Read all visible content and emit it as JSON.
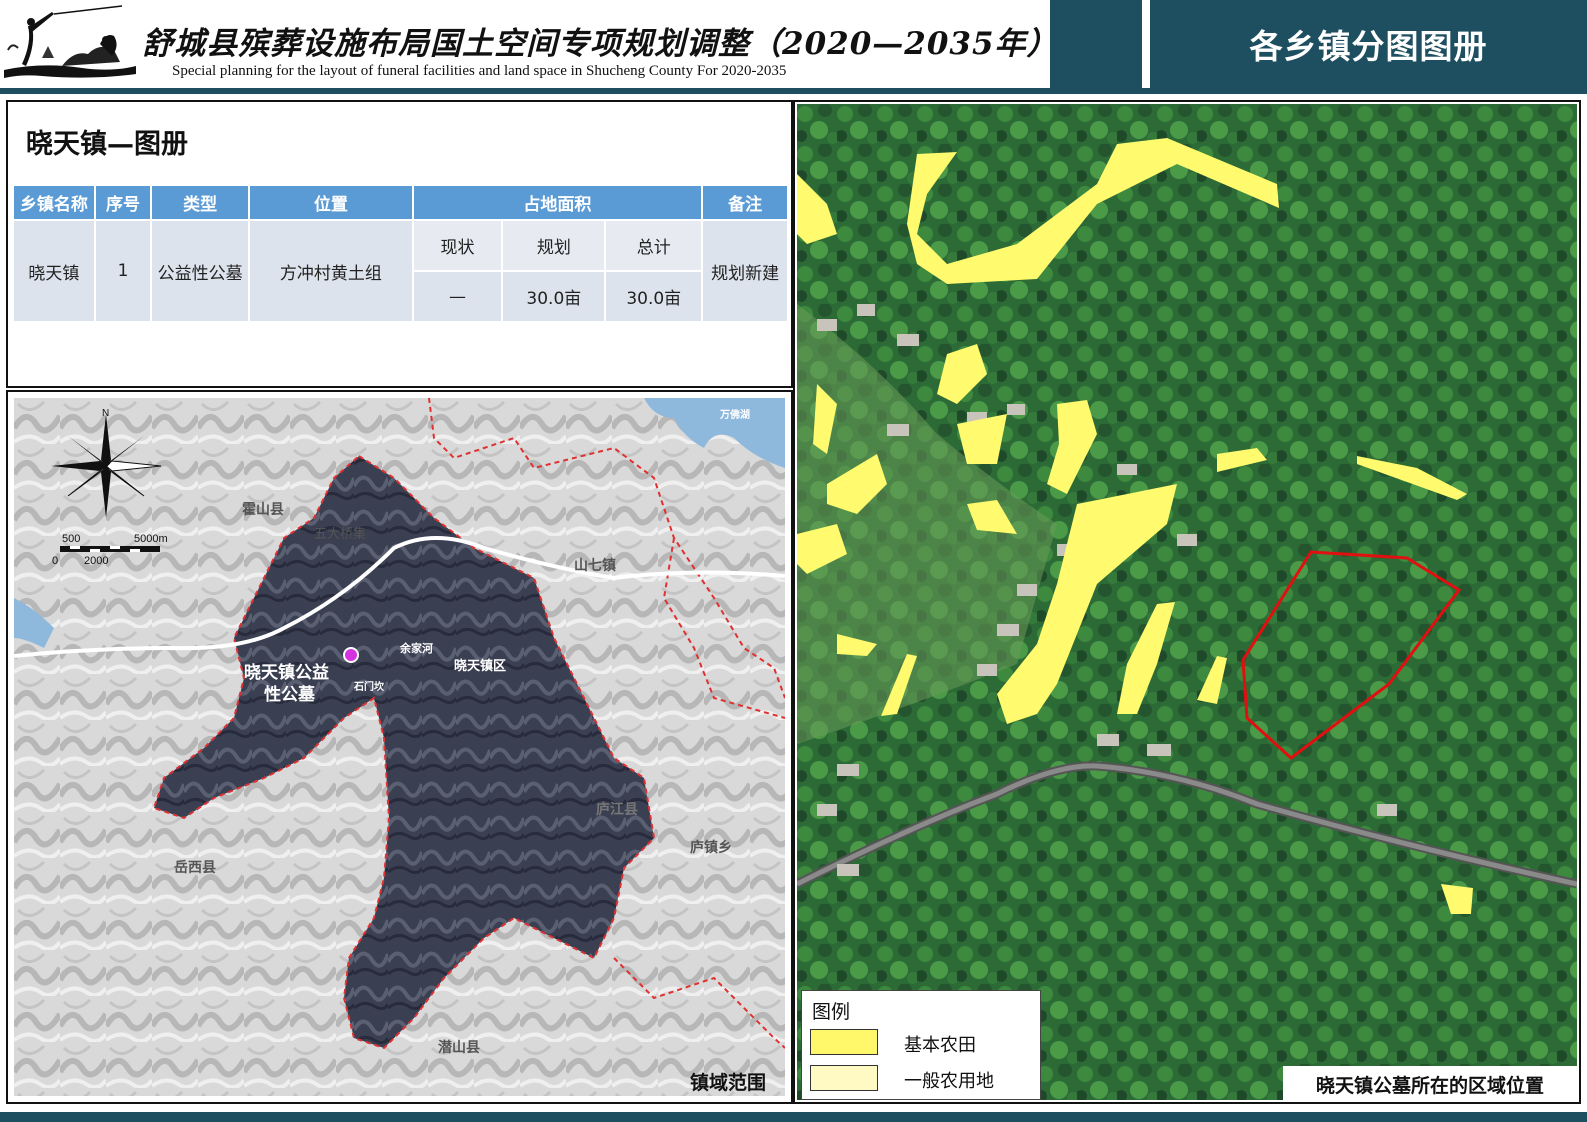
{
  "header": {
    "title_cn": "舒城县殡葬设施布局国土空间专项规划调整（2020—2035年）",
    "title_en": "Special planning for the layout of funeral facilities and land space in Shucheng County For 2020-2035",
    "section_label": "各乡镇分图图册"
  },
  "info": {
    "title": "晓天镇—图册",
    "table": {
      "headers": [
        "乡镇名称",
        "序号",
        "类型",
        "位置",
        "占地面积",
        "备注"
      ],
      "area_subheaders": [
        "现状",
        "规划",
        "总计"
      ],
      "rows": [
        {
          "town": "晓天镇",
          "index": "1",
          "type": "公益性公墓",
          "location": "方冲村黄土组",
          "current": "—",
          "planned": "30.0亩",
          "total": "30.0亩",
          "note": "规划新建"
        }
      ]
    }
  },
  "map_left": {
    "caption": "镇域范围",
    "north_label": "N",
    "scale": {
      "top_left": "500",
      "top_right": "5000m",
      "bottom_left": "0",
      "bottom_mid": "2000"
    },
    "places": {
      "wanfohu": "万佛湖",
      "huoshan": "霍山县",
      "wuxian": "五大桥集",
      "shanqi": "山七镇",
      "yujiahe": "余家河",
      "town_area": "晓天镇区",
      "shimenkan": "石门坎",
      "cemetery_line1": "晓天镇公益",
      "cemetery_line2": "性公墓",
      "yuexi": "岳西县",
      "lujiang": "庐江县",
      "luzhen": "庐镇乡",
      "qianshan": "潜山县"
    },
    "colors": {
      "boundary": "#e03030",
      "road": "#ffffff",
      "cemetery_marker": "#d633e0"
    }
  },
  "map_right": {
    "caption": "晓天镇公墓所在的区域位置",
    "legend": {
      "title": "图例",
      "items": [
        {
          "label": "基本农田",
          "color": "#fff86a"
        },
        {
          "label": "一般农用地",
          "color": "#fff9c4"
        }
      ]
    },
    "colors": {
      "site_outline": "#e01010",
      "farmland": "#fffa6e"
    }
  }
}
